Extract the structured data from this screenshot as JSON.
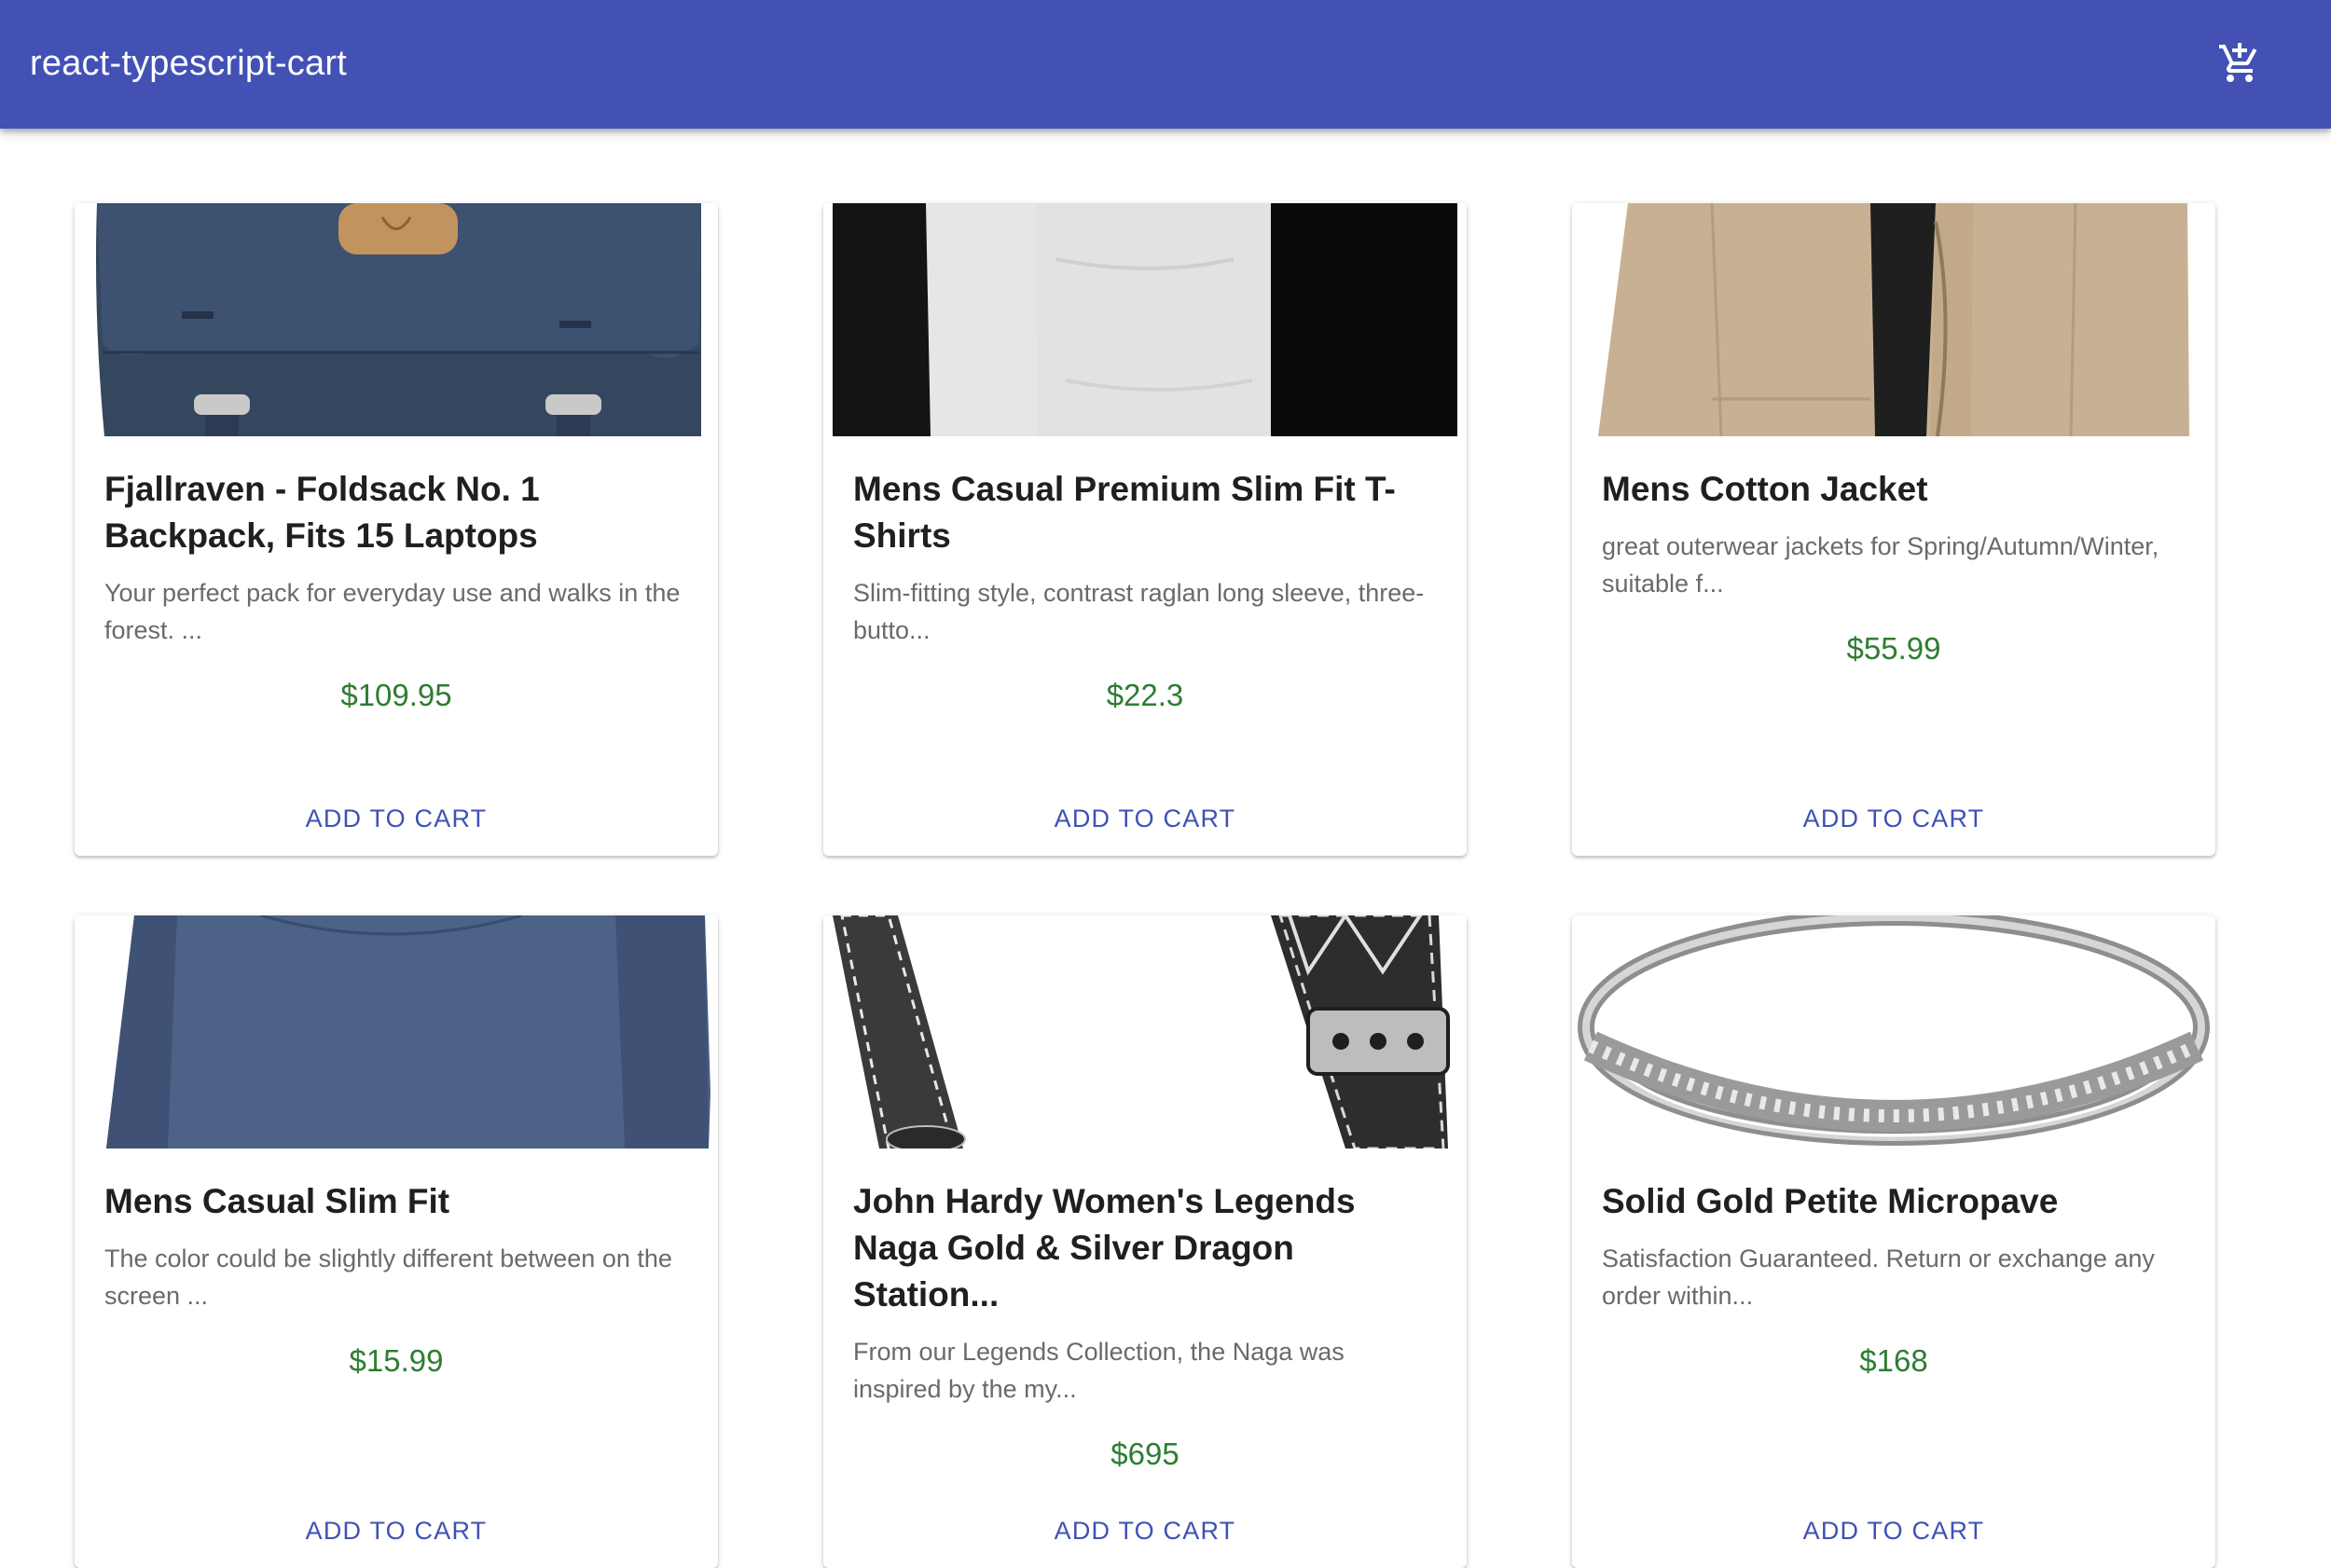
{
  "app": {
    "title": "react-typescript-cart",
    "cart_icon": "add-shopping-cart-icon",
    "bar_color": "#4351b5"
  },
  "theme": {
    "price_color": "#2e7d32",
    "action_color": "#3f51b5"
  },
  "products": [
    {
      "title": "Fjallraven - Foldsack No. 1 Backpack, Fits 15 Laptops",
      "description": "Your perfect pack for everyday use and walks in the forest. ...",
      "price": "$109.95",
      "action": "ADD TO CART",
      "image": "navy-backpack-image"
    },
    {
      "title": "Mens Casual Premium Slim Fit T-Shirts",
      "description": "Slim-fitting style, contrast raglan long sleeve, three-butto...",
      "price": "$22.3",
      "action": "ADD TO CART",
      "image": "raglan-tshirt-image"
    },
    {
      "title": "Mens Cotton Jacket",
      "description": "great outerwear jackets for Spring/Autumn/Winter, suitable f...",
      "price": "$55.99",
      "action": "ADD TO CART",
      "image": "khaki-jacket-image"
    },
    {
      "title": "Mens Casual Slim Fit",
      "description": "The color could be slightly different between on the screen ...",
      "price": "$15.99",
      "action": "ADD TO CART",
      "image": "blue-longsleeve-image"
    },
    {
      "title": "John Hardy Women's Legends Naga Gold & Silver Dragon Station...",
      "description": "From our Legends Collection, the Naga was inspired by the my...",
      "price": "$695",
      "action": "ADD TO CART",
      "image": "chain-bracelet-image"
    },
    {
      "title": "Solid Gold Petite Micropave",
      "description": "Satisfaction Guaranteed. Return or exchange any order within...",
      "price": "$168",
      "action": "ADD TO CART",
      "image": "diamond-ring-image"
    }
  ]
}
